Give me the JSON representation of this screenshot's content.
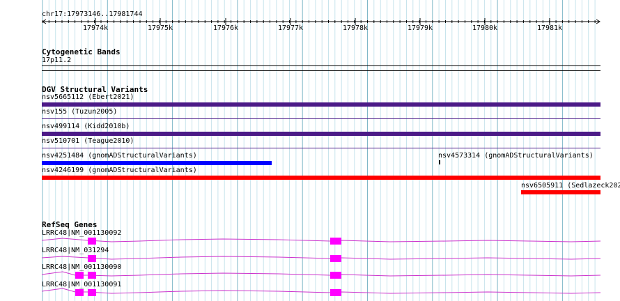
{
  "ruler": {
    "position_label": "chr17:17973146..17981744",
    "ticks": [
      "17974k",
      "17975k",
      "17976k",
      "17977k",
      "17978k",
      "17979k",
      "17980k",
      "17981k"
    ]
  },
  "cytoband": {
    "title": "Cytogenetic Bands",
    "band_label": "17p11.2"
  },
  "dgv": {
    "title": "DGV Structural Variants",
    "variants": [
      {
        "label": "nsv5665112 (Ebert2021)",
        "color": "#4b1a87"
      },
      {
        "label": "nsv155 (Tuzun2005)",
        "color": "#4b1a87"
      },
      {
        "label": "nsv499114 (Kidd2010b)",
        "color": "#4b1a87"
      },
      {
        "label": "nsv510701 (Teague2010)",
        "color": "#4b1a87"
      },
      {
        "label": "nsv4251484 (gnomADStructuralVariants)",
        "color": "#0000ff"
      },
      {
        "label": "nsv4573314 (gnomADStructuralVariants)",
        "color": "#000000"
      },
      {
        "label": "nsv4246199 (gnomADStructuralVariants)",
        "color": "#ff0000"
      },
      {
        "label": "nsv6505911 (Sedlazeck202",
        "color": "#ff0000"
      }
    ]
  },
  "refseq": {
    "title": "RefSeq Genes",
    "exon_color": "#ff00ff",
    "genes": [
      {
        "label": "LRRC48|NM_001130092"
      },
      {
        "label": "LRRC48|NM_031294"
      },
      {
        "label": "LRRC48|NM_001130090"
      },
      {
        "label": "LRRC48|NM_001130091"
      }
    ]
  }
}
